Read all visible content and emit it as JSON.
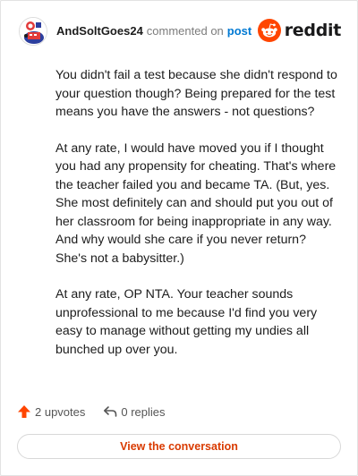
{
  "header": {
    "author": "AndSoltGoes24",
    "action_text": "commented on",
    "post_link": "post",
    "brand": "reddit",
    "brand_color": "#ff4500"
  },
  "comment": {
    "paragraphs": [
      "You didn't fail a test because she didn't respond to your question though? Being prepared for the test means you have the answers - not questions?",
      "At any rate, I would have moved you if I thought you had any propensity for cheating. That's where the teacher failed you and became TA. (But, yes. She most definitely can and should put you out of her classroom for being inappropriate in any way. And why would she care if you never return? She's not a babysitter.)",
      "At any rate, OP NTA. Your teacher sounds unprofessional to me because I'd find you very easy to manage without getting my undies all bunched up over you."
    ]
  },
  "footer": {
    "upvotes": "2 upvotes",
    "replies": "0 replies",
    "upvote_icon": "upvote-arrow-icon",
    "reply_icon": "reply-arrow-icon",
    "upvote_color": "#ff4500",
    "view_conversation": "View the conversation",
    "cta_color": "#d93a00"
  }
}
